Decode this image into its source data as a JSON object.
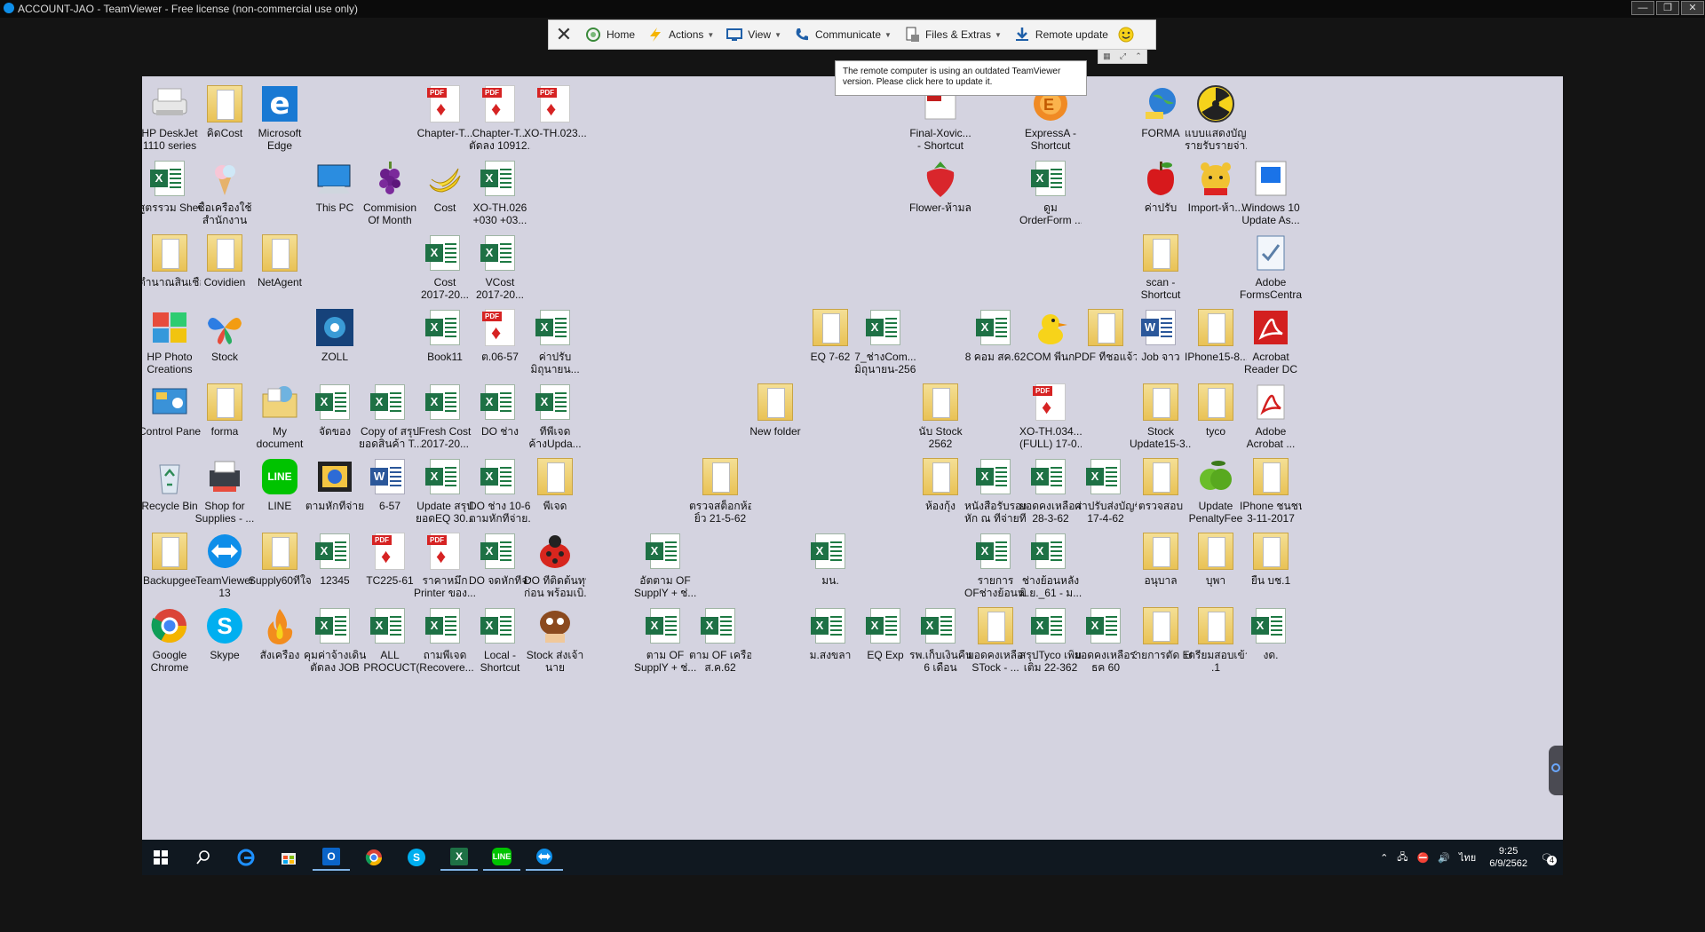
{
  "window": {
    "title": "ACCOUNT-JAO - TeamViewer - Free license (non-commercial use only)",
    "min": "—",
    "restore": "❐",
    "close": "✕"
  },
  "toolbar": {
    "home": "Home",
    "actions": "Actions",
    "view": "View",
    "communicate": "Communicate",
    "files": "Files & Extras",
    "update": "Remote update"
  },
  "tooltip": {
    "line1": "The remote computer is using an outdated TeamViewer",
    "line2": "version. Please click here to update it."
  },
  "desktop": {
    "icons": [
      {
        "name": "hp-deskjet",
        "label": "HP DeskJet",
        "label2": "1110 series",
        "kind": "printer",
        "col": 0,
        "row": 0
      },
      {
        "name": "folder-cost-th",
        "label": "คิดCost",
        "label2": "",
        "kind": "fold",
        "col": 1,
        "row": 0
      },
      {
        "name": "microsoft-edge",
        "label": "Microsoft",
        "label2": "Edge",
        "kind": "edge",
        "col": 2,
        "row": 0
      },
      {
        "name": "pdf-chapter-1",
        "label": "Chapter-T...",
        "label2": "",
        "kind": "pdf",
        "col": 5,
        "row": 0
      },
      {
        "name": "pdf-chapter-2",
        "label": "Chapter-T...",
        "label2": "ตัดลง 10912...",
        "kind": "pdf",
        "col": 6,
        "row": 0
      },
      {
        "name": "pdf-xo-th-023",
        "label": "XO-TH.023...",
        "label2": "",
        "kind": "pdf",
        "col": 7,
        "row": 0
      },
      {
        "name": "final-xovic-shortcut",
        "label": "Final-Xovic...",
        "label2": "- Shortcut",
        "kind": "pdfred",
        "col": 14,
        "row": 0
      },
      {
        "name": "expressa-shortcut",
        "label": "ExpressA -",
        "label2": "Shortcut",
        "kind": "express",
        "col": 16,
        "row": 0
      },
      {
        "name": "forma-app",
        "label": "FORMA",
        "label2": "",
        "kind": "globe",
        "col": 18,
        "row": 0
      },
      {
        "name": "radiation-app",
        "label": "แบบแสดงบัญชี",
        "label2": "รายรับรายจ่า...",
        "kind": "radiation",
        "col": 19,
        "row": 0
      },
      {
        "name": "xl-sutra-sheet",
        "label": "สูตรรวม Sheet",
        "label2": "",
        "kind": "xl",
        "col": 0,
        "row": 1
      },
      {
        "name": "ice-cream-app",
        "label": "ซื้อเครื่องใช้",
        "label2": "สำนักงาน",
        "kind": "icecream",
        "col": 1,
        "row": 1
      },
      {
        "name": "this-pc",
        "label": "This PC",
        "label2": "",
        "kind": "pc",
        "col": 3,
        "row": 1
      },
      {
        "name": "grape-commission",
        "label": "Commision",
        "label2": "Of Month",
        "kind": "grape",
        "col": 4,
        "row": 1
      },
      {
        "name": "banana-cost",
        "label": "Cost",
        "label2": "",
        "kind": "banana",
        "col": 5,
        "row": 1
      },
      {
        "name": "xl-xo-th-026",
        "label": "XO-TH.026",
        "label2": "+030 +03...",
        "kind": "xl",
        "col": 6,
        "row": 1
      },
      {
        "name": "strawberry-flower",
        "label": "Flower-ห้ามลบ",
        "label2": "",
        "kind": "strawberry",
        "col": 14,
        "row": 1
      },
      {
        "name": "xl-orderform",
        "label": "ดูม",
        "label2": "OrderForm ...",
        "kind": "xl",
        "col": 16,
        "row": 1
      },
      {
        "name": "apple-payment",
        "label": "ค่าปรับ",
        "label2": "",
        "kind": "apple",
        "col": 18,
        "row": 1
      },
      {
        "name": "pooh-import",
        "label": "Import-ห้า...",
        "label2": "",
        "kind": "pooh",
        "col": 19,
        "row": 1
      },
      {
        "name": "win10-update",
        "label": "Windows 10",
        "label2": "Update As...",
        "kind": "winupd",
        "col": 20,
        "row": 1
      },
      {
        "name": "folder-tamnan",
        "label": "ตำนาณสินเชื่อ",
        "label2": "",
        "kind": "fold",
        "col": 0,
        "row": 2
      },
      {
        "name": "folder-covidien",
        "label": "Covidien",
        "label2": "",
        "kind": "fold",
        "col": 1,
        "row": 2
      },
      {
        "name": "folder-netagent",
        "label": "NetAgent",
        "label2": "",
        "kind": "fold",
        "col": 2,
        "row": 2
      },
      {
        "name": "xl-cost-2017",
        "label": "Cost",
        "label2": "2017-20...",
        "kind": "xl",
        "col": 5,
        "row": 2
      },
      {
        "name": "xl-vcost-2017",
        "label": "VCost",
        "label2": "2017-20...",
        "kind": "xl",
        "col": 6,
        "row": 2
      },
      {
        "name": "scan-shortcut",
        "label": "scan -",
        "label2": "Shortcut",
        "kind": "fold",
        "col": 18,
        "row": 2
      },
      {
        "name": "adobe-formscentral",
        "label": "Adobe",
        "label2": "FormsCentral",
        "kind": "formscentral",
        "col": 20,
        "row": 2
      },
      {
        "name": "hp-photo",
        "label": "HP Photo",
        "label2": "Creations",
        "kind": "hpphoto",
        "col": 0,
        "row": 3
      },
      {
        "name": "stock-app",
        "label": "Stock",
        "label2": "",
        "kind": "butterfly",
        "col": 1,
        "row": 3
      },
      {
        "name": "zoll-app",
        "label": "ZOLL",
        "label2": "",
        "kind": "zoll",
        "col": 3,
        "row": 3
      },
      {
        "name": "xl-book11",
        "label": "Book11",
        "label2": "",
        "kind": "xl",
        "col": 5,
        "row": 3
      },
      {
        "name": "pdf-oct-06-57",
        "label": "ต.06-57",
        "label2": "",
        "kind": "pdf",
        "col": 6,
        "row": 3
      },
      {
        "name": "xl-kaparp",
        "label": "ค่าปรับ",
        "label2": "มิถุนายน...",
        "kind": "xl",
        "col": 7,
        "row": 3
      },
      {
        "name": "folder-eq-7-62",
        "label": "EQ 7-62",
        "label2": "",
        "kind": "fold",
        "col": 12,
        "row": 3
      },
      {
        "name": "xl-7-com",
        "label": "7_ช่างCom...",
        "label2": "มิถุนายน-2562",
        "kind": "xl",
        "col": 13,
        "row": 3
      },
      {
        "name": "xl-8-com",
        "label": "8 คอม สค.62",
        "label2": "",
        "kind": "xl",
        "col": 15,
        "row": 3
      },
      {
        "name": "duck-com",
        "label": "COM พี่นก",
        "label2": "",
        "kind": "duck",
        "col": 16,
        "row": 3
      },
      {
        "name": "folder-pdf",
        "label": "PDF ที่ชอแจ้ว",
        "label2": "",
        "kind": "fold",
        "col": 17,
        "row": 3
      },
      {
        "name": "word-job",
        "label": "Job จาว",
        "label2": "",
        "kind": "word",
        "col": 18,
        "row": 3
      },
      {
        "name": "folder-iphone15",
        "label": "IPhone15-8...",
        "label2": "",
        "kind": "fold",
        "col": 19,
        "row": 3
      },
      {
        "name": "acrobat-reader-dc",
        "label": "Acrobat",
        "label2": "Reader DC",
        "kind": "acrobat",
        "col": 20,
        "row": 3
      },
      {
        "name": "control-panel",
        "label": "Control Panel",
        "label2": "",
        "kind": "control",
        "col": 0,
        "row": 4
      },
      {
        "name": "folder-forma",
        "label": "forma",
        "label2": "",
        "kind": "fold",
        "col": 1,
        "row": 4
      },
      {
        "name": "my-document",
        "label": "My",
        "label2": "document",
        "kind": "mydoc",
        "col": 2,
        "row": 4
      },
      {
        "name": "xl-jadkong",
        "label": "จัดของ",
        "label2": "",
        "kind": "xl",
        "col": 3,
        "row": 4
      },
      {
        "name": "xl-copy-of",
        "label": "Copy of สรุป",
        "label2": "ยอดสินค้า T...",
        "kind": "xl",
        "col": 4,
        "row": 4
      },
      {
        "name": "xl-fresh-cost",
        "label": "Fresh Cost",
        "label2": "2017-20...",
        "kind": "xl",
        "col": 5,
        "row": 4
      },
      {
        "name": "xl-do-chang",
        "label": "DO ช่าง",
        "label2": "",
        "kind": "xl",
        "col": 6,
        "row": 4
      },
      {
        "name": "xl-pheejeed",
        "label": "ที่พี่เจด",
        "label2": "ค้างUpda...",
        "kind": "xl",
        "col": 7,
        "row": 4
      },
      {
        "name": "folder-new",
        "label": "New folder",
        "label2": "",
        "kind": "fold",
        "col": 11,
        "row": 4
      },
      {
        "name": "folder-stock-2562",
        "label": "นับ Stock",
        "label2": "2562",
        "kind": "fold",
        "col": 14,
        "row": 4
      },
      {
        "name": "pdf-xo-th-034",
        "label": "XO-TH.034...",
        "label2": "(FULL) 17-0...",
        "kind": "pdf",
        "col": 16,
        "row": 4
      },
      {
        "name": "folder-stock-update",
        "label": "Stock",
        "label2": "Update15-3...",
        "kind": "fold",
        "col": 18,
        "row": 4
      },
      {
        "name": "folder-tyco",
        "label": "tyco",
        "label2": "",
        "kind": "fold",
        "col": 19,
        "row": 4
      },
      {
        "name": "adobe-acrobat",
        "label": "Adobe",
        "label2": "Acrobat ...",
        "kind": "acrobat2",
        "col": 20,
        "row": 4
      },
      {
        "name": "recycle-bin",
        "label": "Recycle Bin",
        "label2": "",
        "kind": "recycle",
        "col": 0,
        "row": 5
      },
      {
        "name": "shop-for-supplies",
        "label": "Shop for",
        "label2": "Supplies - ...",
        "kind": "shop",
        "col": 1,
        "row": 5
      },
      {
        "name": "line-app",
        "label": "LINE",
        "label2": "",
        "kind": "line",
        "col": 2,
        "row": 5
      },
      {
        "name": "stamp-app",
        "label": "ตามหักที่จ่าย",
        "label2": "",
        "kind": "stamp",
        "col": 3,
        "row": 5
      },
      {
        "name": "word-6-57",
        "label": "6-57",
        "label2": "",
        "kind": "word",
        "col": 4,
        "row": 5
      },
      {
        "name": "xl-update-eq",
        "label": "Update สรุป",
        "label2": "ยอดEQ 30...",
        "kind": "xl",
        "col": 5,
        "row": 5
      },
      {
        "name": "xl-do-chang-10-61",
        "label": "DO ช่าง 10-61",
        "label2": "ตามหักที่จ่าย...",
        "kind": "xl",
        "col": 6,
        "row": 5
      },
      {
        "name": "folder-phee",
        "label": "พี่เจด",
        "label2": "",
        "kind": "fold",
        "col": 7,
        "row": 5
      },
      {
        "name": "folder-check-stock",
        "label": "ตรวจสต็อกห้อง",
        "label2": "ยิ้ว 21-5-62",
        "kind": "fold",
        "col": 10,
        "row": 5
      },
      {
        "name": "folder-hong-kung",
        "label": "ห้องกุ้ง",
        "label2": "",
        "kind": "fold",
        "col": 14,
        "row": 5
      },
      {
        "name": "xl-nangsue",
        "label": "หนังสือรับรอง",
        "label2": "หัก ณ ที่จ่ายที่...",
        "kind": "xl",
        "col": 15,
        "row": 5
      },
      {
        "name": "xl-yodkong-28",
        "label": "ยอดคงเหลือ ณ",
        "label2": "28-3-62",
        "kind": "xl",
        "col": 16,
        "row": 5
      },
      {
        "name": "xl-kaparp-17",
        "label": "ค่าปรับส่งบัญชี",
        "label2": "17-4-62",
        "kind": "xl",
        "col": 17,
        "row": 5
      },
      {
        "name": "folder-truat",
        "label": "ตรวจสอบ",
        "label2": "",
        "kind": "fold",
        "col": 18,
        "row": 5
      },
      {
        "name": "apple-update-penalty",
        "label": "Update",
        "label2": "PenaltyFee",
        "kind": "greenapple",
        "col": 19,
        "row": 5
      },
      {
        "name": "iphone-folder",
        "label": "IPhone ชนชน",
        "label2": "3-11-2017",
        "kind": "fold",
        "col": 20,
        "row": 5
      },
      {
        "name": "folder-backupgee",
        "label": "Backupgee",
        "label2": "",
        "kind": "fold",
        "col": 0,
        "row": 6
      },
      {
        "name": "teamviewer-13",
        "label": "TeamViewer",
        "label2": "13",
        "kind": "teamviewer",
        "col": 1,
        "row": 6
      },
      {
        "name": "folder-supply60",
        "label": "Supply60ที่ใจ",
        "label2": "",
        "kind": "fold",
        "col": 2,
        "row": 6
      },
      {
        "name": "xl-12345",
        "label": "12345",
        "label2": "",
        "kind": "xl",
        "col": 3,
        "row": 6
      },
      {
        "name": "pdf-tc225",
        "label": "TC225-61",
        "label2": "",
        "kind": "pdf",
        "col": 4,
        "row": 6
      },
      {
        "name": "pdf-printer",
        "label": "ราคาหมึก",
        "label2": "Printer ของ...",
        "kind": "pdf",
        "col": 5,
        "row": 6
      },
      {
        "name": "xl-do-jod",
        "label": "DO จดหักที่จ่าย",
        "label2": "",
        "kind": "xl",
        "col": 6,
        "row": 6
      },
      {
        "name": "ladybug-do",
        "label": "DO ที่ติดต้นทุน",
        "label2": "ก่อน พร้อมเบิ...",
        "kind": "ladybug",
        "col": 7,
        "row": 6
      },
      {
        "name": "xl-supply-of",
        "label": "อัตตาม OF",
        "label2": "SupplY + ช่...",
        "kind": "xl",
        "col": 9,
        "row": 6
      },
      {
        "name": "xl-mon",
        "label": "มน.",
        "label2": "",
        "kind": "xl",
        "col": 12,
        "row": 6
      },
      {
        "name": "xl-raikan",
        "label": "รายการ",
        "label2": "OFช่างย้อนห...",
        "kind": "xl",
        "col": 15,
        "row": 6
      },
      {
        "name": "xl-chang-yon",
        "label": "ช่างย้อนหลัง",
        "label2": "มิ.ย._61 - ม...",
        "kind": "xl",
        "col": 16,
        "row": 6
      },
      {
        "name": "folder-anuban",
        "label": "อนุบาล",
        "label2": "",
        "kind": "fold",
        "col": 18,
        "row": 6
      },
      {
        "name": "folder-boopha",
        "label": "บุพา",
        "label2": "",
        "kind": "fold",
        "col": 19,
        "row": 6
      },
      {
        "name": "folder-yuen",
        "label": "ยื่น บช.1",
        "label2": "",
        "kind": "fold",
        "col": 20,
        "row": 6
      },
      {
        "name": "google-chrome",
        "label": "Google",
        "label2": "Chrome",
        "kind": "chrome",
        "col": 0,
        "row": 7
      },
      {
        "name": "skype",
        "label": "Skype",
        "label2": "",
        "kind": "skype",
        "col": 1,
        "row": 7
      },
      {
        "name": "fire-app",
        "label": "สั่งเครื่อง",
        "label2": "",
        "kind": "fire",
        "col": 2,
        "row": 7
      },
      {
        "name": "xl-khum-job",
        "label": "คุมค่าจ้างเดินท่อ",
        "label2": "ตัดลง JOB",
        "kind": "xl",
        "col": 3,
        "row": 7
      },
      {
        "name": "xl-all-product",
        "label": "ALL",
        "label2": "PROCUCT",
        "kind": "xl",
        "col": 4,
        "row": 7
      },
      {
        "name": "xl-recovered",
        "label": "ถามพี่เจด",
        "label2": "(Recovere...",
        "kind": "xl",
        "col": 5,
        "row": 7
      },
      {
        "name": "xl-local-shortcut",
        "label": "Local -",
        "label2": "Shortcut",
        "kind": "xl",
        "col": 6,
        "row": 7
      },
      {
        "name": "goomba-stock",
        "label": "Stock ส่งเจ้า",
        "label2": "นาย",
        "kind": "goomba",
        "col": 7,
        "row": 7
      },
      {
        "name": "xl-tam-of",
        "label": "ตาม OF",
        "label2": "SupplY + ช่...",
        "kind": "xl",
        "col": 9,
        "row": 7
      },
      {
        "name": "xl-tam-of-kr",
        "label": "ตาม OF เครื่อง",
        "label2": "ส.ค.62",
        "kind": "xl",
        "col": 10,
        "row": 7
      },
      {
        "name": "xl-m-songkhla",
        "label": "ม.สงขลา",
        "label2": "",
        "kind": "xl",
        "col": 12,
        "row": 7
      },
      {
        "name": "xl-eq-exp",
        "label": "EQ Exp",
        "label2": "",
        "kind": "xl",
        "col": 13,
        "row": 7
      },
      {
        "name": "xl-rp-kep",
        "label": "รพ.เก็บเงินคืน",
        "label2": "6 เดือน",
        "kind": "xl",
        "col": 14,
        "row": 7
      },
      {
        "name": "folder-yodkong-stock",
        "label": "ยอดคงเหลือ",
        "label2": "STock - ...",
        "kind": "fold",
        "col": 15,
        "row": 7
      },
      {
        "name": "xl-sarup-tyco",
        "label": "สรุปTyco เพิ่ม",
        "label2": "เติม 22-362",
        "kind": "xl",
        "col": 16,
        "row": 7
      },
      {
        "name": "xl-yodkong-31",
        "label": "ยอดคงเหลือ 31",
        "label2": "ธค 60",
        "kind": "xl",
        "col": 17,
        "row": 7
      },
      {
        "name": "folder-raikan-eq",
        "label": "รายการตัด EQ",
        "label2": "",
        "kind": "fold",
        "col": 18,
        "row": 7
      },
      {
        "name": "folder-triam",
        "label": "เตรียมสอบเข้า ป",
        "label2": ".1",
        "kind": "fold",
        "col": 19,
        "row": 7
      },
      {
        "name": "xl-ngod",
        "label": "งด.",
        "label2": "",
        "kind": "xl",
        "col": 20,
        "row": 7
      }
    ]
  },
  "taskbar": {
    "lang": "ไทย",
    "time": "9:25",
    "date": "6/9/2562",
    "notif_count": "4"
  }
}
